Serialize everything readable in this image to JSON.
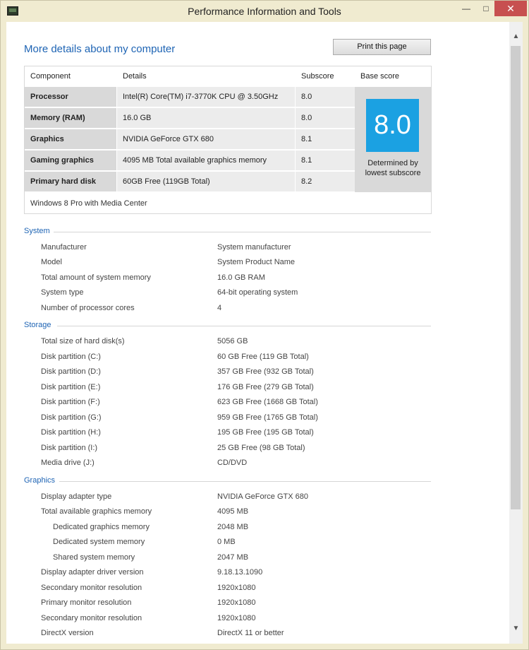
{
  "window": {
    "title": "Performance Information and Tools",
    "min_glyph": "—",
    "max_glyph": "□",
    "close_glyph": "✕"
  },
  "header": {
    "heading": "More details about my computer",
    "print_label": "Print this page"
  },
  "scores": {
    "columns": [
      "Component",
      "Details",
      "Subscore",
      "Base score"
    ],
    "rows": [
      {
        "component": "Processor",
        "details": "Intel(R) Core(TM) i7-3770K CPU @ 3.50GHz",
        "subscore": "8.0"
      },
      {
        "component": "Memory (RAM)",
        "details": "16.0 GB",
        "subscore": "8.0"
      },
      {
        "component": "Graphics",
        "details": "NVIDIA GeForce GTX 680",
        "subscore": "8.1"
      },
      {
        "component": "Gaming graphics",
        "details": "4095 MB Total available graphics memory",
        "subscore": "8.1"
      },
      {
        "component": "Primary hard disk",
        "details": "60GB Free (119GB Total)",
        "subscore": "8.2"
      }
    ],
    "base_score": "8.0",
    "base_note_line1": "Determined by",
    "base_note_line2": "lowest subscore",
    "os": "Windows 8 Pro with Media Center"
  },
  "system": {
    "title": "System",
    "items": [
      {
        "label": "Manufacturer",
        "value": "System manufacturer"
      },
      {
        "label": "Model",
        "value": "System Product Name"
      },
      {
        "label": "Total amount of system memory",
        "value": "16.0 GB RAM"
      },
      {
        "label": "System type",
        "value": "64-bit operating system"
      },
      {
        "label": "Number of processor cores",
        "value": "4"
      }
    ]
  },
  "storage": {
    "title": "Storage",
    "items": [
      {
        "label": "Total size of hard disk(s)",
        "value": "5056 GB"
      },
      {
        "label": "Disk partition (C:)",
        "value": "60 GB Free (119 GB Total)"
      },
      {
        "label": "Disk partition (D:)",
        "value": "357 GB Free (932 GB Total)"
      },
      {
        "label": "Disk partition (E:)",
        "value": "176 GB Free (279 GB Total)"
      },
      {
        "label": "Disk partition (F:)",
        "value": "623 GB Free (1668 GB Total)"
      },
      {
        "label": "Disk partition (G:)",
        "value": "959 GB Free (1765 GB Total)"
      },
      {
        "label": "Disk partition (H:)",
        "value": "195 GB Free (195 GB Total)"
      },
      {
        "label": "Disk partition (I:)",
        "value": "25 GB Free (98 GB Total)"
      },
      {
        "label": "Media drive (J:)",
        "value": "CD/DVD"
      }
    ]
  },
  "graphics": {
    "title": "Graphics",
    "items": [
      {
        "label": "Display adapter type",
        "value": "NVIDIA GeForce GTX 680"
      },
      {
        "label": "Total available graphics memory",
        "value": "4095 MB"
      },
      {
        "label": "Dedicated graphics memory",
        "value": "2048 MB"
      },
      {
        "label": "Dedicated system memory",
        "value": "0 MB"
      },
      {
        "label": "Shared system memory",
        "value": "2047 MB"
      },
      {
        "label": "Display adapter driver version",
        "value": "9.18.13.1090"
      },
      {
        "label": "Secondary monitor resolution",
        "value": "1920x1080"
      },
      {
        "label": "Primary monitor resolution",
        "value": "1920x1080"
      },
      {
        "label": "Secondary monitor resolution",
        "value": "1920x1080"
      },
      {
        "label": "DirectX version",
        "value": "DirectX 11 or better"
      }
    ]
  }
}
